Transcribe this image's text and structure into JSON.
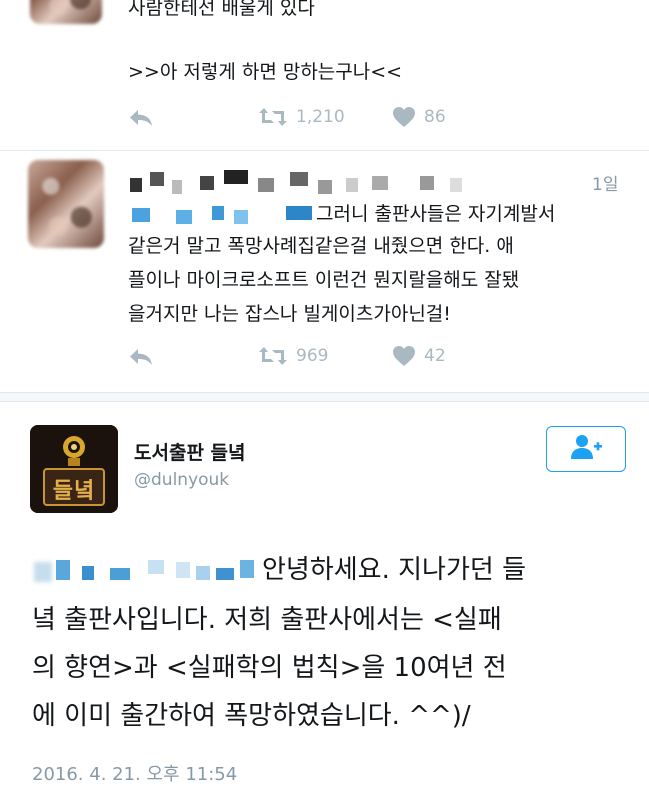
{
  "tweet1": {
    "text_line1": "사람한테선 배울게 있다",
    "text_line2": ">>아 저렇게 하면 망하는구나<<",
    "retweets": "1,210",
    "likes": "86"
  },
  "tweet2": {
    "time": "1일",
    "lines": [
      "그러니 출판사들은 자기계발서",
      "같은거 말고 폭망사례집같은걸 내줬으면 한다. 애",
      "플이나 마이크로소프트 이런건 뭔지랄을해도 잘됐",
      "을거지만 나는 잡스나 빌게이츠가아닌걸!"
    ],
    "retweets": "969",
    "likes": "42"
  },
  "main_tweet": {
    "display_name": "도서출판 들녘",
    "handle": "@dulnyouk",
    "logo_text": "들녘",
    "lines": [
      "안녕하세요. 지나가던 들",
      "녘 출판사입니다. 저희 출판사에서는 <실패",
      "의 향연>과 <실패학의 법칙>을 10여년 전",
      "에 이미 출간하여 폭망하였습니다. ^^)/"
    ],
    "timestamp": "2016. 4. 21. 오후 11:54"
  },
  "icons": {
    "reply": "reply-icon",
    "retweet": "retweet-icon",
    "like": "heart-icon",
    "follow": "add-user-icon"
  },
  "colors": {
    "icon_gray": "#aab8c2",
    "accent_blue": "#1da1f2",
    "text": "#14171a",
    "meta_gray": "#8899a6"
  }
}
